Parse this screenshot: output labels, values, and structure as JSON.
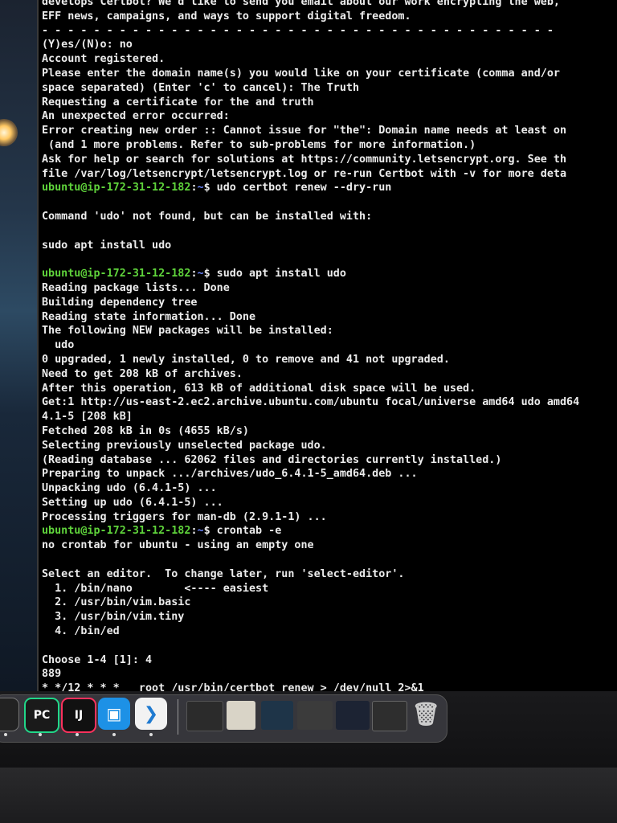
{
  "terminal": {
    "lines": [
      {
        "text": "develops Certbot? We'd like to send you email about our work encrypting the web,"
      },
      {
        "text": "EFF news, campaigns, and ways to support digital freedom."
      },
      {
        "text": "- - - - - - - - - - - - - - - - - - - - - - - - - - - - - - - - - - - - - - - -"
      },
      {
        "text": "(Y)es/(N)o: no"
      },
      {
        "text": "Account registered."
      },
      {
        "text": "Please enter the domain name(s) you would like on your certificate (comma and/or"
      },
      {
        "text": "space separated) (Enter 'c' to cancel): The Truth"
      },
      {
        "text": "Requesting a certificate for the and truth"
      },
      {
        "text": "An unexpected error occurred:"
      },
      {
        "text": "Error creating new order :: Cannot issue for \"the\": Domain name needs at least on"
      },
      {
        "text": " (and 1 more problems. Refer to sub-problems for more information.)"
      },
      {
        "text": "Ask for help or search for solutions at https://community.letsencrypt.org. See th"
      },
      {
        "text": "file /var/log/letsencrypt/letsencrypt.log or re-run Certbot with -v for more deta"
      },
      {
        "user": "ubuntu@ip-172-31-12-182",
        "sep": ":",
        "path": "~",
        "text": "$ udo certbot renew --dry-run"
      },
      {
        "text": ""
      },
      {
        "text": "Command 'udo' not found, but can be installed with:"
      },
      {
        "text": ""
      },
      {
        "text": "sudo apt install udo"
      },
      {
        "text": ""
      },
      {
        "user": "ubuntu@ip-172-31-12-182",
        "sep": ":",
        "path": "~",
        "text": "$ sudo apt install udo"
      },
      {
        "text": "Reading package lists... Done"
      },
      {
        "text": "Building dependency tree"
      },
      {
        "text": "Reading state information... Done"
      },
      {
        "text": "The following NEW packages will be installed:"
      },
      {
        "text": "  udo"
      },
      {
        "text": "0 upgraded, 1 newly installed, 0 to remove and 41 not upgraded."
      },
      {
        "text": "Need to get 208 kB of archives."
      },
      {
        "text": "After this operation, 613 kB of additional disk space will be used."
      },
      {
        "text": "Get:1 http://us-east-2.ec2.archive.ubuntu.com/ubuntu focal/universe amd64 udo amd64"
      },
      {
        "text": "4.1-5 [208 kB]"
      },
      {
        "text": "Fetched 208 kB in 0s (4655 kB/s)"
      },
      {
        "text": "Selecting previously unselected package udo."
      },
      {
        "text": "(Reading database ... 62062 files and directories currently installed.)"
      },
      {
        "text": "Preparing to unpack .../archives/udo_6.4.1-5_amd64.deb ..."
      },
      {
        "text": "Unpacking udo (6.4.1-5) ..."
      },
      {
        "text": "Setting up udo (6.4.1-5) ..."
      },
      {
        "text": "Processing triggers for man-db (2.9.1-1) ..."
      },
      {
        "user": "ubuntu@ip-172-31-12-182",
        "sep": ":",
        "path": "~",
        "text": "$ crontab -e"
      },
      {
        "text": "no crontab for ubuntu - using an empty one"
      },
      {
        "text": ""
      },
      {
        "text": "Select an editor.  To change later, run 'select-editor'."
      },
      {
        "text": "  1. /bin/nano        <---- easiest"
      },
      {
        "text": "  2. /usr/bin/vim.basic"
      },
      {
        "text": "  3. /usr/bin/vim.tiny"
      },
      {
        "text": "  4. /bin/ed"
      },
      {
        "text": ""
      },
      {
        "text": "Choose 1-4 [1]: 4"
      },
      {
        "text": "889"
      },
      {
        "text": "* */12 * * *   root /usr/bin/certbot renew > /dev/null 2>&1"
      },
      {
        "text": "?"
      }
    ]
  },
  "dock": {
    "pycharm_label": "PC",
    "intellij_label": "IJ"
  },
  "colors": {
    "prompt_user": "#5fd33b",
    "prompt_path": "#6c86ff",
    "text": "#ececec"
  }
}
